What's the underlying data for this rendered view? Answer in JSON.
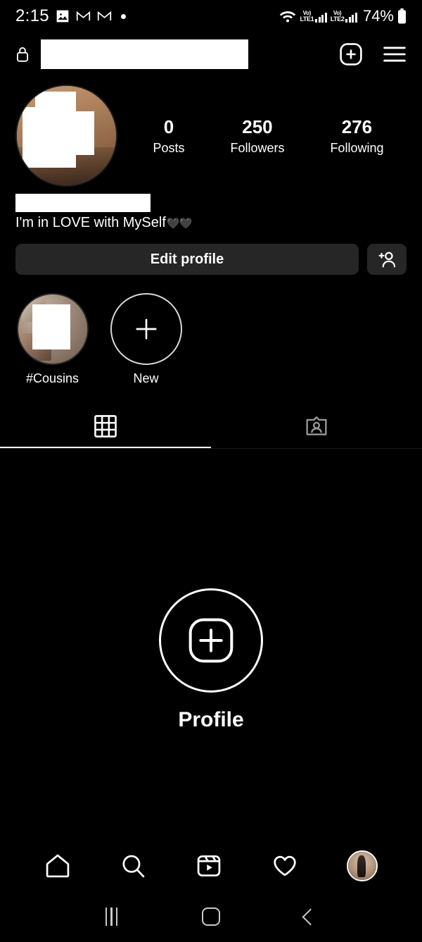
{
  "status_bar": {
    "time": "2:15",
    "icons": [
      "gallery-icon",
      "gmail-icon",
      "gmail-icon",
      "dot-indicator"
    ],
    "wifi": "wifi-icon",
    "sim1_volte": "Vo)",
    "sim1_network": "LTE1",
    "sim2_volte": "Vo)",
    "sim2_network": "LTE2",
    "battery_percent": "74%"
  },
  "app_bar": {
    "lock_icon": "lock-icon",
    "username_redacted": "",
    "add_icon": "plus-square-icon",
    "menu_icon": "hamburger-menu-icon"
  },
  "profile": {
    "avatar": "profile-avatar",
    "name_redacted": "",
    "bio": "I'm in LOVE with MySelf",
    "bio_emoji": "🖤🖤",
    "stats": [
      {
        "value": "0",
        "label": "Posts"
      },
      {
        "value": "250",
        "label": "Followers"
      },
      {
        "value": "276",
        "label": "Following"
      }
    ]
  },
  "actions": {
    "edit_profile": "Edit profile",
    "add_person_icon": "add-person-icon"
  },
  "highlights": [
    {
      "label": "#Cousins",
      "type": "story"
    },
    {
      "label": "New",
      "type": "new"
    }
  ],
  "tabs": [
    {
      "name": "grid-tab",
      "icon": "grid-icon",
      "active": true
    },
    {
      "name": "tagged-tab",
      "icon": "tagged-person-icon",
      "active": false
    }
  ],
  "empty_state": {
    "icon": "create-post-icon",
    "title": "Profile"
  },
  "bottom_nav": [
    {
      "name": "home",
      "icon": "home-icon"
    },
    {
      "name": "search",
      "icon": "search-icon"
    },
    {
      "name": "reels",
      "icon": "reels-icon"
    },
    {
      "name": "activity",
      "icon": "heart-icon"
    },
    {
      "name": "profile",
      "icon": "avatar-icon",
      "active": true
    }
  ],
  "system_nav": {
    "recents": "recents-button",
    "home": "home-button",
    "back": "back-button"
  },
  "colors": {
    "background": "#000000",
    "button": "#262626",
    "text": "#ffffff"
  }
}
